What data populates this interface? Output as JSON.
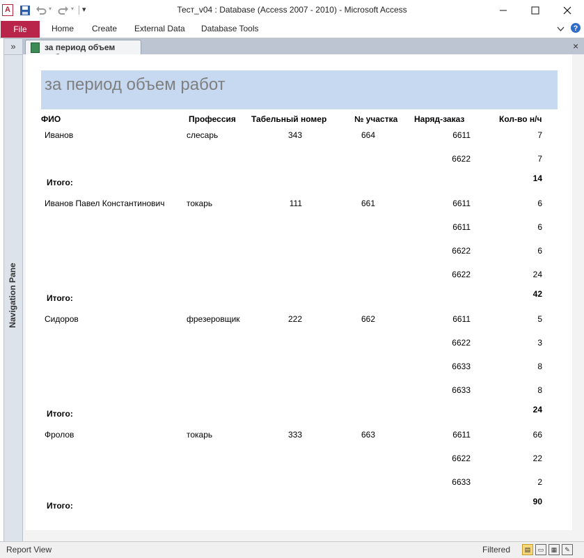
{
  "window": {
    "title": "Тест_v04 : Database (Access 2007 - 2010)  -  Microsoft Access",
    "app_icon_letter": "A"
  },
  "ribbon": {
    "file_label": "File",
    "tabs": [
      "Home",
      "Create",
      "External Data",
      "Database Tools"
    ]
  },
  "nav_pane": {
    "toggle": "»",
    "label": "Navigation Pane"
  },
  "doc_tab": {
    "label": "за период объем работ",
    "close": "×"
  },
  "report": {
    "title": "за период объем работ",
    "headers": [
      "ФИО",
      "Профессия",
      "Табельный номер",
      "№ участка",
      "Наряд-заказ",
      "Кол-во н/ч"
    ],
    "total_label": "Итого:",
    "groups": [
      {
        "name": "Иванов",
        "profession": "слесарь",
        "tab_no": "343",
        "section": "664",
        "rows": [
          {
            "order": "6611",
            "qty": "7"
          },
          {
            "order": "6622",
            "qty": "7"
          }
        ],
        "total": "14"
      },
      {
        "name": "Иванов Павел Константинович",
        "profession": "токарь",
        "tab_no": "111",
        "section": "661",
        "rows": [
          {
            "order": "6611",
            "qty": "6"
          },
          {
            "order": "6611",
            "qty": "6"
          },
          {
            "order": "6622",
            "qty": "6"
          },
          {
            "order": "6622",
            "qty": "24"
          }
        ],
        "total": "42"
      },
      {
        "name": "Сидоров",
        "profession": "фрезеровщик",
        "tab_no": "222",
        "section": "662",
        "rows": [
          {
            "order": "6611",
            "qty": "5"
          },
          {
            "order": "6622",
            "qty": "3"
          },
          {
            "order": "6633",
            "qty": "8"
          },
          {
            "order": "6633",
            "qty": "8"
          }
        ],
        "total": "24"
      },
      {
        "name": "Фролов",
        "profession": "токарь",
        "tab_no": "333",
        "section": "663",
        "rows": [
          {
            "order": "6611",
            "qty": "66"
          },
          {
            "order": "6622",
            "qty": "22"
          },
          {
            "order": "6633",
            "qty": "2"
          }
        ],
        "total": "90"
      }
    ]
  },
  "statusbar": {
    "view": "Report View",
    "filtered": "Filtered"
  },
  "colors": {
    "file_tab": "#b9244b",
    "title_band": "#c6d9f1"
  }
}
